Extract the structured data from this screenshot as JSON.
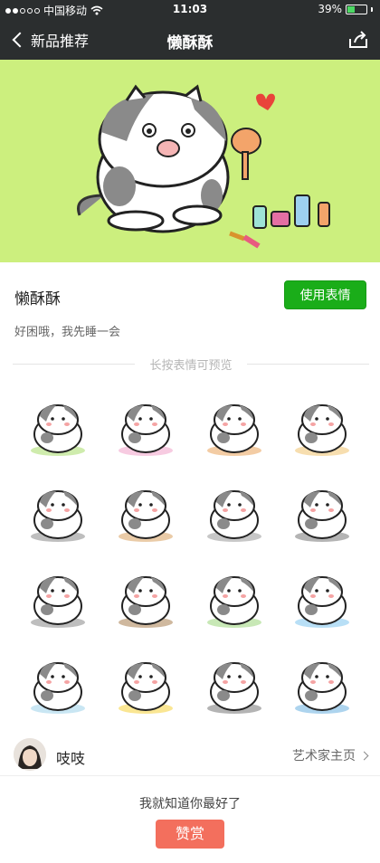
{
  "status_bar": {
    "carrier": "中国移动",
    "time": "11:03",
    "battery_percent_text": "39%",
    "battery_level": 0.39,
    "icons": [
      "signal-dots-icon",
      "wifi-icon",
      "battery-icon"
    ]
  },
  "nav": {
    "back_label": "新品推荐",
    "title": "懒酥酥",
    "share_icon": "share-icon"
  },
  "colors": {
    "nav_bg": "#2b2e2f",
    "banner_bg": "#ccef7e",
    "use_button": "#1aad19",
    "reward_button": "#f36f5d",
    "battery_fill": "#4cd964"
  },
  "pack": {
    "title": "懒酥酥",
    "use_button_label": "使用表情",
    "description": "好困哦，我先睡一会",
    "preview_hint": "长按表情可预览"
  },
  "stickers": [
    {
      "icon": "cat-lying-on-float-icon"
    },
    {
      "icon": "cat-with-hairdryer-icon"
    },
    {
      "icon": "cat-on-box-icon"
    },
    {
      "icon": "cat-in-tub-icon"
    },
    {
      "icon": "cat-stretching-icon"
    },
    {
      "icon": "cat-eating-icon"
    },
    {
      "icon": "cat-surprised-icon"
    },
    {
      "icon": "cat-tumbling-icon"
    },
    {
      "icon": "cat-crawling-icon"
    },
    {
      "icon": "cat-thinking-food-icon"
    },
    {
      "icon": "cat-swimming-ring-icon"
    },
    {
      "icon": "cat-at-window-icon"
    },
    {
      "icon": "cat-crying-icon"
    },
    {
      "icon": "cat-sunflower-icon"
    },
    {
      "icon": "cat-sleeping-icon"
    },
    {
      "icon": "cat-holding-fish-icon"
    }
  ],
  "artist": {
    "name": "吱吱",
    "link_label": "艺术家主页"
  },
  "reward": {
    "text": "我就知道你最好了",
    "button_label": "赞赏"
  }
}
